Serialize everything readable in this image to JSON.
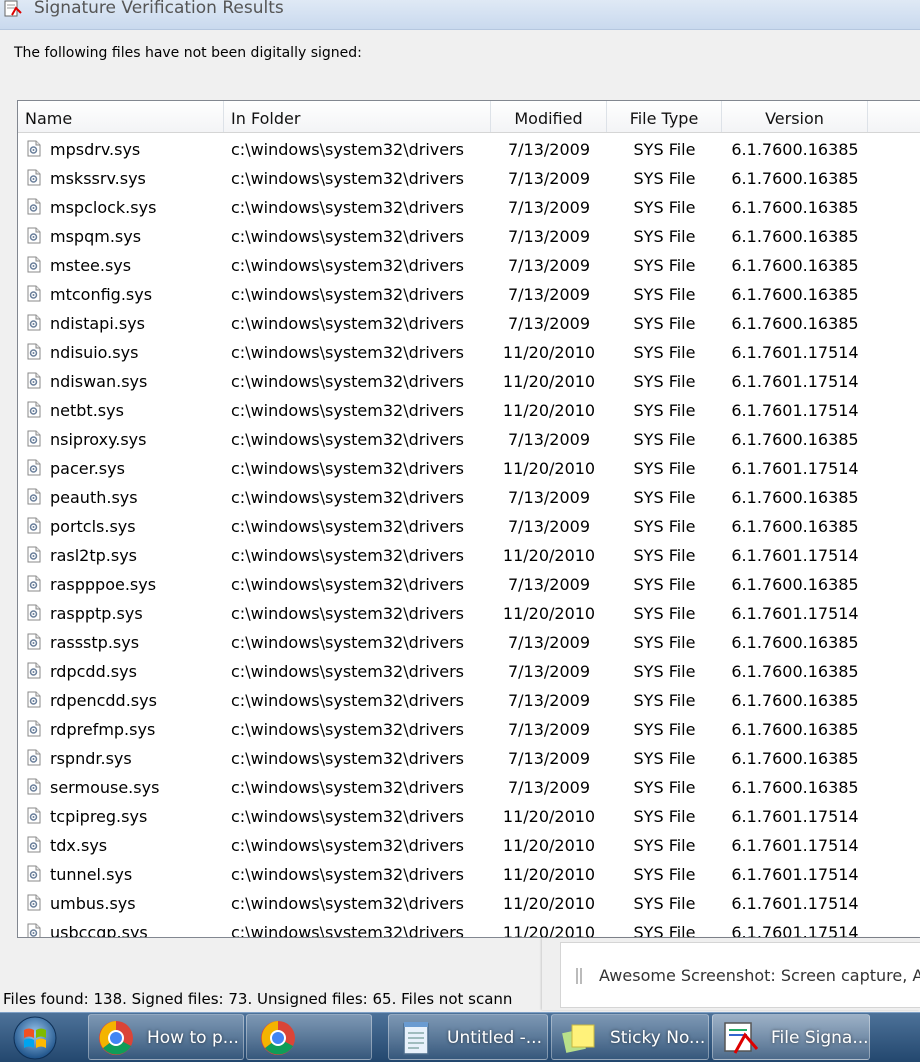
{
  "window": {
    "title": "Signature Verification Results",
    "intro": "The following files have not been digitally signed:"
  },
  "columns": {
    "name": "Name",
    "folder": "In Folder",
    "modified": "Modified",
    "type": "File Type",
    "version": "Version"
  },
  "rows": [
    {
      "name": "mpsdrv.sys",
      "folder": "c:\\windows\\system32\\drivers",
      "modified": "7/13/2009",
      "type": "SYS File",
      "version": "6.1.7600.16385"
    },
    {
      "name": "mskssrv.sys",
      "folder": "c:\\windows\\system32\\drivers",
      "modified": "7/13/2009",
      "type": "SYS File",
      "version": "6.1.7600.16385"
    },
    {
      "name": "mspclock.sys",
      "folder": "c:\\windows\\system32\\drivers",
      "modified": "7/13/2009",
      "type": "SYS File",
      "version": "6.1.7600.16385"
    },
    {
      "name": "mspqm.sys",
      "folder": "c:\\windows\\system32\\drivers",
      "modified": "7/13/2009",
      "type": "SYS File",
      "version": "6.1.7600.16385"
    },
    {
      "name": "mstee.sys",
      "folder": "c:\\windows\\system32\\drivers",
      "modified": "7/13/2009",
      "type": "SYS File",
      "version": "6.1.7600.16385"
    },
    {
      "name": "mtconfig.sys",
      "folder": "c:\\windows\\system32\\drivers",
      "modified": "7/13/2009",
      "type": "SYS File",
      "version": "6.1.7600.16385"
    },
    {
      "name": "ndistapi.sys",
      "folder": "c:\\windows\\system32\\drivers",
      "modified": "7/13/2009",
      "type": "SYS File",
      "version": "6.1.7600.16385"
    },
    {
      "name": "ndisuio.sys",
      "folder": "c:\\windows\\system32\\drivers",
      "modified": "11/20/2010",
      "type": "SYS File",
      "version": "6.1.7601.17514"
    },
    {
      "name": "ndiswan.sys",
      "folder": "c:\\windows\\system32\\drivers",
      "modified": "11/20/2010",
      "type": "SYS File",
      "version": "6.1.7601.17514"
    },
    {
      "name": "netbt.sys",
      "folder": "c:\\windows\\system32\\drivers",
      "modified": "11/20/2010",
      "type": "SYS File",
      "version": "6.1.7601.17514"
    },
    {
      "name": "nsiproxy.sys",
      "folder": "c:\\windows\\system32\\drivers",
      "modified": "7/13/2009",
      "type": "SYS File",
      "version": "6.1.7600.16385"
    },
    {
      "name": "pacer.sys",
      "folder": "c:\\windows\\system32\\drivers",
      "modified": "11/20/2010",
      "type": "SYS File",
      "version": "6.1.7601.17514"
    },
    {
      "name": "peauth.sys",
      "folder": "c:\\windows\\system32\\drivers",
      "modified": "7/13/2009",
      "type": "SYS File",
      "version": "6.1.7600.16385"
    },
    {
      "name": "portcls.sys",
      "folder": "c:\\windows\\system32\\drivers",
      "modified": "7/13/2009",
      "type": "SYS File",
      "version": "6.1.7600.16385"
    },
    {
      "name": "rasl2tp.sys",
      "folder": "c:\\windows\\system32\\drivers",
      "modified": "11/20/2010",
      "type": "SYS File",
      "version": "6.1.7601.17514"
    },
    {
      "name": "raspppoe.sys",
      "folder": "c:\\windows\\system32\\drivers",
      "modified": "7/13/2009",
      "type": "SYS File",
      "version": "6.1.7600.16385"
    },
    {
      "name": "raspptp.sys",
      "folder": "c:\\windows\\system32\\drivers",
      "modified": "11/20/2010",
      "type": "SYS File",
      "version": "6.1.7601.17514"
    },
    {
      "name": "rassstp.sys",
      "folder": "c:\\windows\\system32\\drivers",
      "modified": "7/13/2009",
      "type": "SYS File",
      "version": "6.1.7600.16385"
    },
    {
      "name": "rdpcdd.sys",
      "folder": "c:\\windows\\system32\\drivers",
      "modified": "7/13/2009",
      "type": "SYS File",
      "version": "6.1.7600.16385"
    },
    {
      "name": "rdpencdd.sys",
      "folder": "c:\\windows\\system32\\drivers",
      "modified": "7/13/2009",
      "type": "SYS File",
      "version": "6.1.7600.16385"
    },
    {
      "name": "rdprefmp.sys",
      "folder": "c:\\windows\\system32\\drivers",
      "modified": "7/13/2009",
      "type": "SYS File",
      "version": "6.1.7600.16385"
    },
    {
      "name": "rspndr.sys",
      "folder": "c:\\windows\\system32\\drivers",
      "modified": "7/13/2009",
      "type": "SYS File",
      "version": "6.1.7600.16385"
    },
    {
      "name": "sermouse.sys",
      "folder": "c:\\windows\\system32\\drivers",
      "modified": "7/13/2009",
      "type": "SYS File",
      "version": "6.1.7600.16385"
    },
    {
      "name": "tcpipreg.sys",
      "folder": "c:\\windows\\system32\\drivers",
      "modified": "11/20/2010",
      "type": "SYS File",
      "version": "6.1.7601.17514"
    },
    {
      "name": "tdx.sys",
      "folder": "c:\\windows\\system32\\drivers",
      "modified": "11/20/2010",
      "type": "SYS File",
      "version": "6.1.7601.17514"
    },
    {
      "name": "tunnel.sys",
      "folder": "c:\\windows\\system32\\drivers",
      "modified": "11/20/2010",
      "type": "SYS File",
      "version": "6.1.7601.17514"
    },
    {
      "name": "umbus.sys",
      "folder": "c:\\windows\\system32\\drivers",
      "modified": "11/20/2010",
      "type": "SYS File",
      "version": "6.1.7601.17514"
    },
    {
      "name": "usbccgp.sys",
      "folder": "c:\\windows\\system32\\drivers",
      "modified": "11/20/2010",
      "type": "SYS File",
      "version": "6.1.7601.17514"
    }
  ],
  "status": {
    "text": "Files found: 138.  Signed files: 73.  Unsigned files: 65.  Files not scann"
  },
  "notification": {
    "text": "Awesome Screenshot: Screen capture, Ann"
  },
  "taskbar": {
    "items": [
      {
        "label": "How to p...",
        "icon": "chrome-icon"
      },
      {
        "label": "",
        "icon": "chrome-icon"
      },
      {
        "label": "Untitled -...",
        "icon": "notepad-icon"
      },
      {
        "label": "Sticky No...",
        "icon": "sticky-notes-icon"
      },
      {
        "label": "File Signa...",
        "icon": "file-signature-icon"
      }
    ]
  },
  "colors": {
    "accent": "#23476e",
    "list_border": "#828790"
  }
}
